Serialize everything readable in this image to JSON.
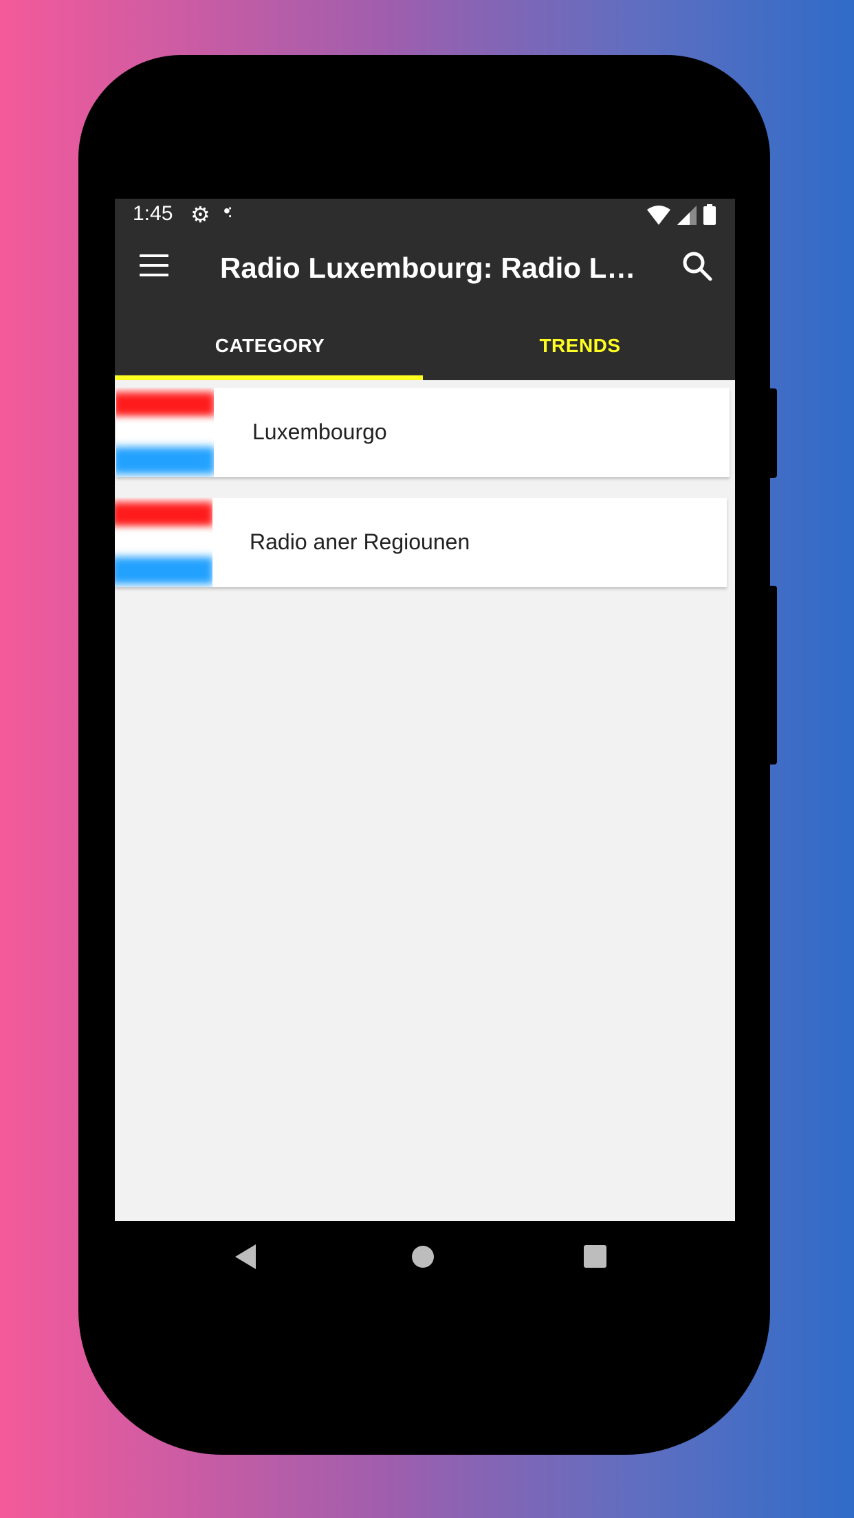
{
  "status_bar": {
    "time": "1:45",
    "left_icons": [
      "gear-icon",
      "dots-icon"
    ],
    "right_icons": [
      "wifi-icon",
      "signal-icon",
      "battery-icon"
    ]
  },
  "app_bar": {
    "title": "Radio Luxembourg: Radio Lux…",
    "menu_icon": "hamburger-menu-icon",
    "search_icon": "search-icon"
  },
  "tabs": [
    {
      "label": "CATEGORY",
      "selected": true
    },
    {
      "label": "TRENDS",
      "selected": false
    }
  ],
  "list": {
    "items": [
      {
        "label": "Luxembourgo",
        "thumbnail": "luxembourg-flag-icon"
      },
      {
        "label": "Radio aner Regiounen",
        "thumbnail": "luxembourg-flag-icon"
      }
    ]
  },
  "nav_bar": {
    "buttons": [
      "back-icon",
      "home-icon",
      "recents-icon"
    ]
  },
  "colors": {
    "toolbar": "#2d2d2d",
    "tab_indicator": "#ffff22",
    "selected_tab_text": "#ffffff",
    "other_tab_text": "#ffff22",
    "background": "#f2f2f2",
    "flag_red": "#ff1b1b",
    "flag_blue": "#22a1ff"
  }
}
